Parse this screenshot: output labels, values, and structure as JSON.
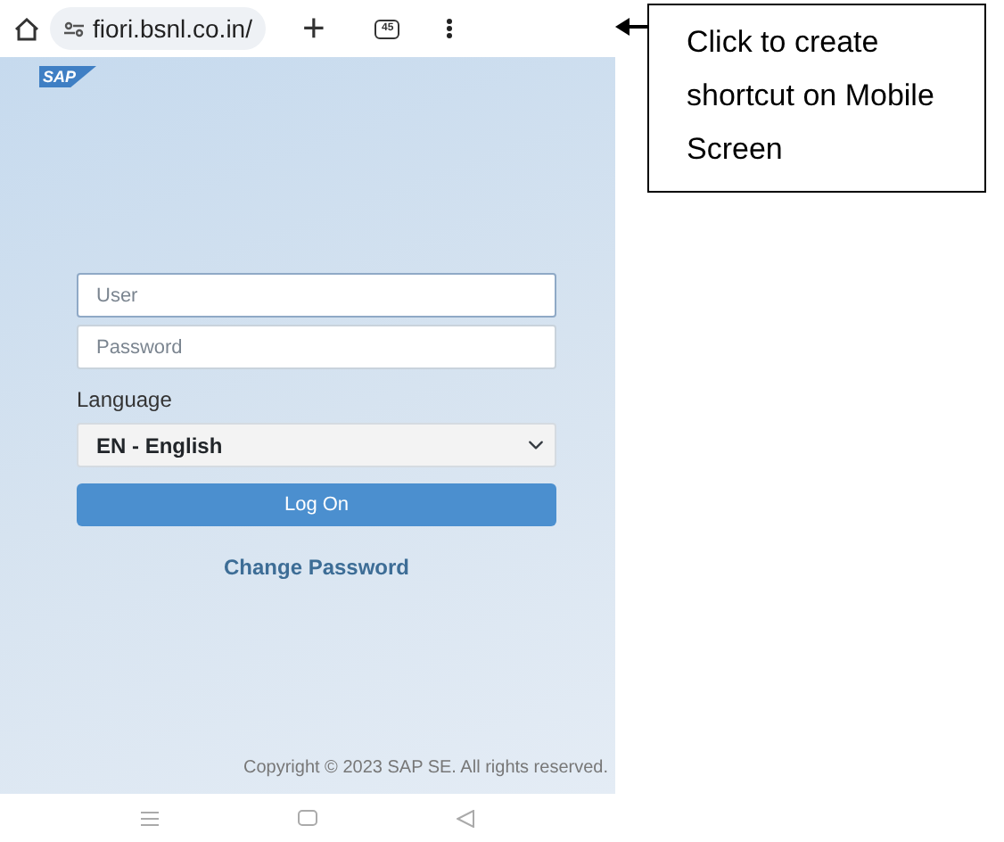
{
  "browser_bar": {
    "url": "fiori.bsnl.co.in/",
    "new_tab": "+",
    "tab_count": "45"
  },
  "logo": "SAP",
  "login_form": {
    "user": {
      "placeholder": "User"
    },
    "password": {
      "placeholder": "Password"
    },
    "language_label": "Language",
    "language": {
      "value": "EN - English"
    },
    "log_on_button": "Log On",
    "change_password_link": "Change Password"
  },
  "copyright": "Copyright © 2023 SAP SE. All rights reserved.",
  "annotation": {
    "text": "Click to create shortcut on Mobile Screen"
  }
}
